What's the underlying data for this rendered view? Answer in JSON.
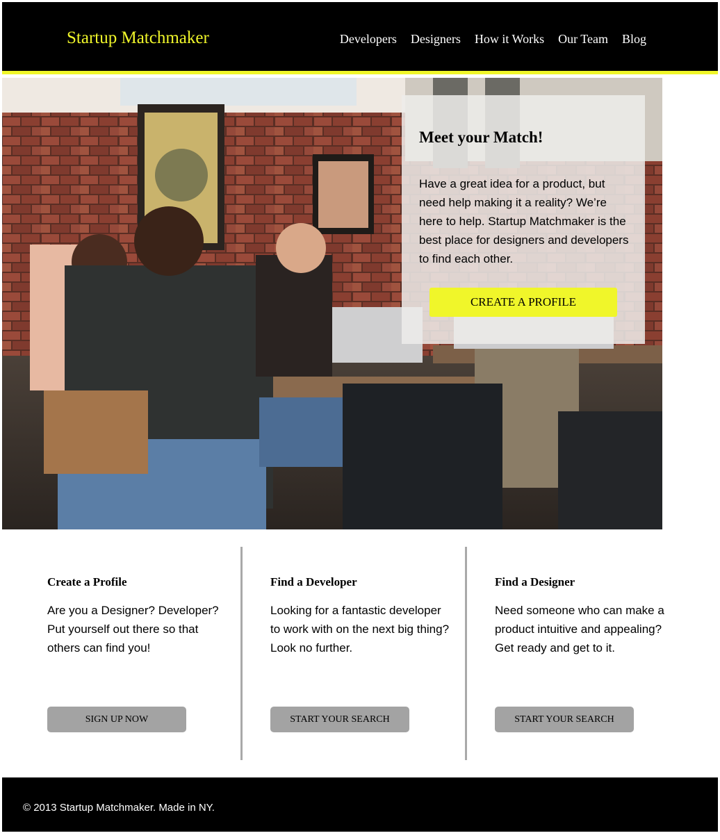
{
  "header": {
    "logo": "Startup Matchmaker",
    "nav": [
      "Developers",
      "Designers",
      "How it Works",
      "Our Team",
      "Blog"
    ]
  },
  "hero": {
    "title": "Meet your Match!",
    "text": "Have a great idea for a product, but need help making it a reality? We’re here to help. Startup Matchmaker is the best place for designers and developers to find each other.",
    "cta": "CREATE A PROFILE"
  },
  "features": [
    {
      "title": "Create a Profile",
      "text": "Are you a Designer? Developer? Put yourself out there so that others can find you!",
      "button": "SIGN UP NOW"
    },
    {
      "title": "Find a Developer",
      "text": "Looking for a fantastic developer to work with on the next big thing? Look no further.",
      "button": "START YOUR SEARCH"
    },
    {
      "title": "Find a Designer",
      "text": "Need someone who can make a product intuitive and appealing? Get ready and get to it.",
      "button": "START YOUR SEARCH"
    }
  ],
  "footer": {
    "text": "© 2013 Startup Matchmaker. Made in NY."
  },
  "colors": {
    "accent": "#f0f62a",
    "header_bg": "#000000",
    "button_gray": "#a3a3a3",
    "divider": "#a9a9a9"
  }
}
